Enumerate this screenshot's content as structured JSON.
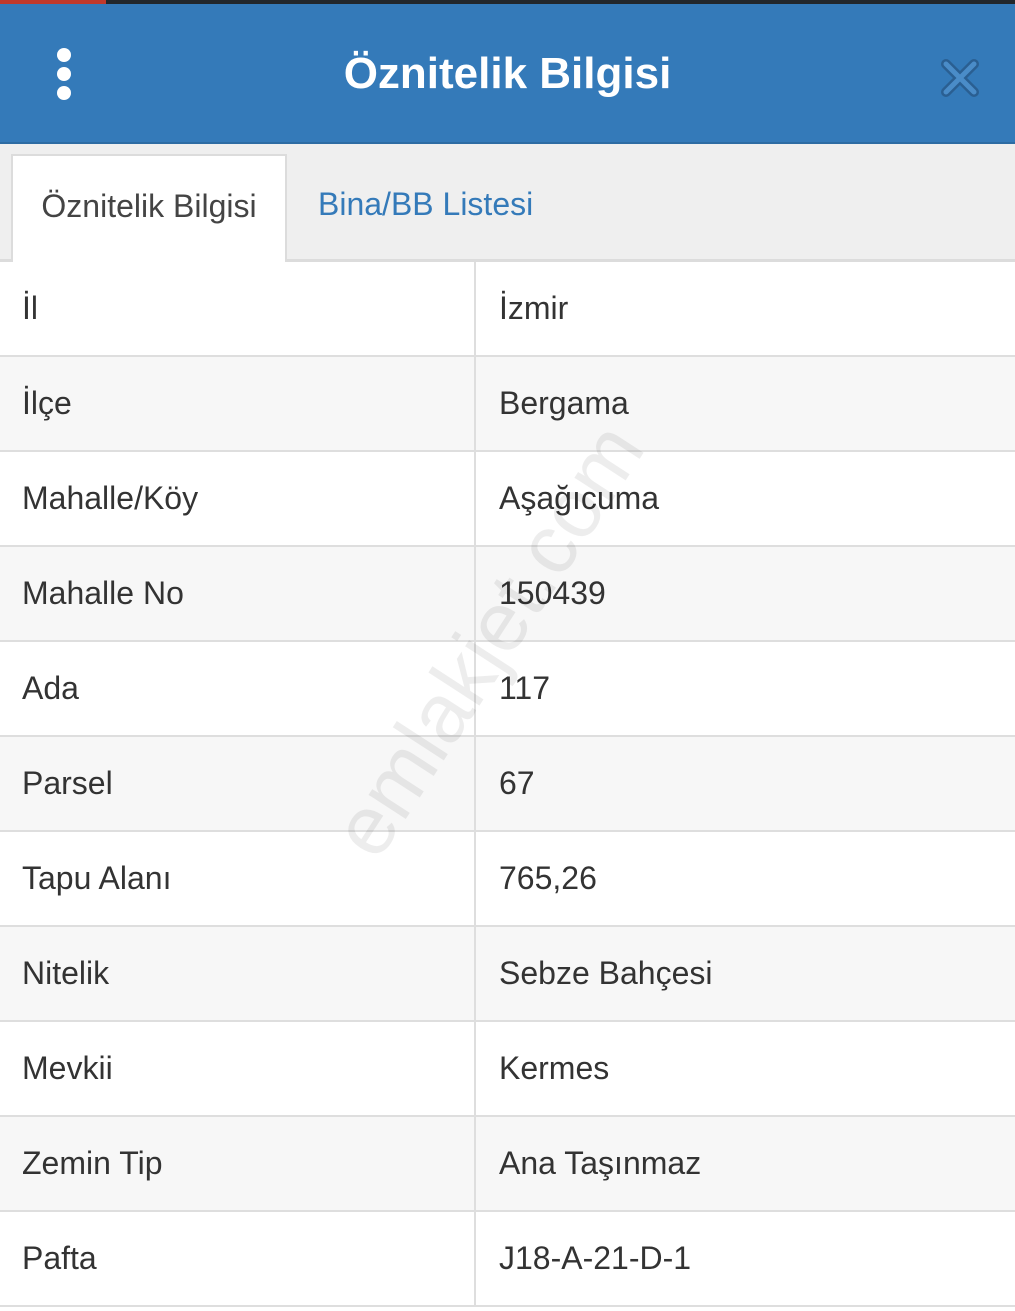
{
  "header": {
    "title": "Öznitelik Bilgisi",
    "background_color": "#347ab9",
    "menu_icon": "vertical-dots-icon",
    "close_icon": "close-x-icon"
  },
  "tabs": [
    {
      "label": "Öznitelik Bilgisi",
      "active": true
    },
    {
      "label": "Bina/BB Listesi",
      "active": false
    }
  ],
  "attributes": [
    {
      "label": "İl",
      "value": "İzmir"
    },
    {
      "label": "İlçe",
      "value": "Bergama"
    },
    {
      "label": "Mahalle/Köy",
      "value": "Aşağıcuma"
    },
    {
      "label": "Mahalle No",
      "value": "150439"
    },
    {
      "label": "Ada",
      "value": "117"
    },
    {
      "label": "Parsel",
      "value": "67"
    },
    {
      "label": "Tapu Alanı",
      "value": "765,26"
    },
    {
      "label": "Nitelik",
      "value": "Sebze Bahçesi"
    },
    {
      "label": "Mevkii",
      "value": "Kermes"
    },
    {
      "label": "Zemin Tip",
      "value": "Ana Taşınmaz"
    },
    {
      "label": "Pafta",
      "value": "J18-A-21-D-1"
    }
  ],
  "watermark": "emlakjet.com"
}
